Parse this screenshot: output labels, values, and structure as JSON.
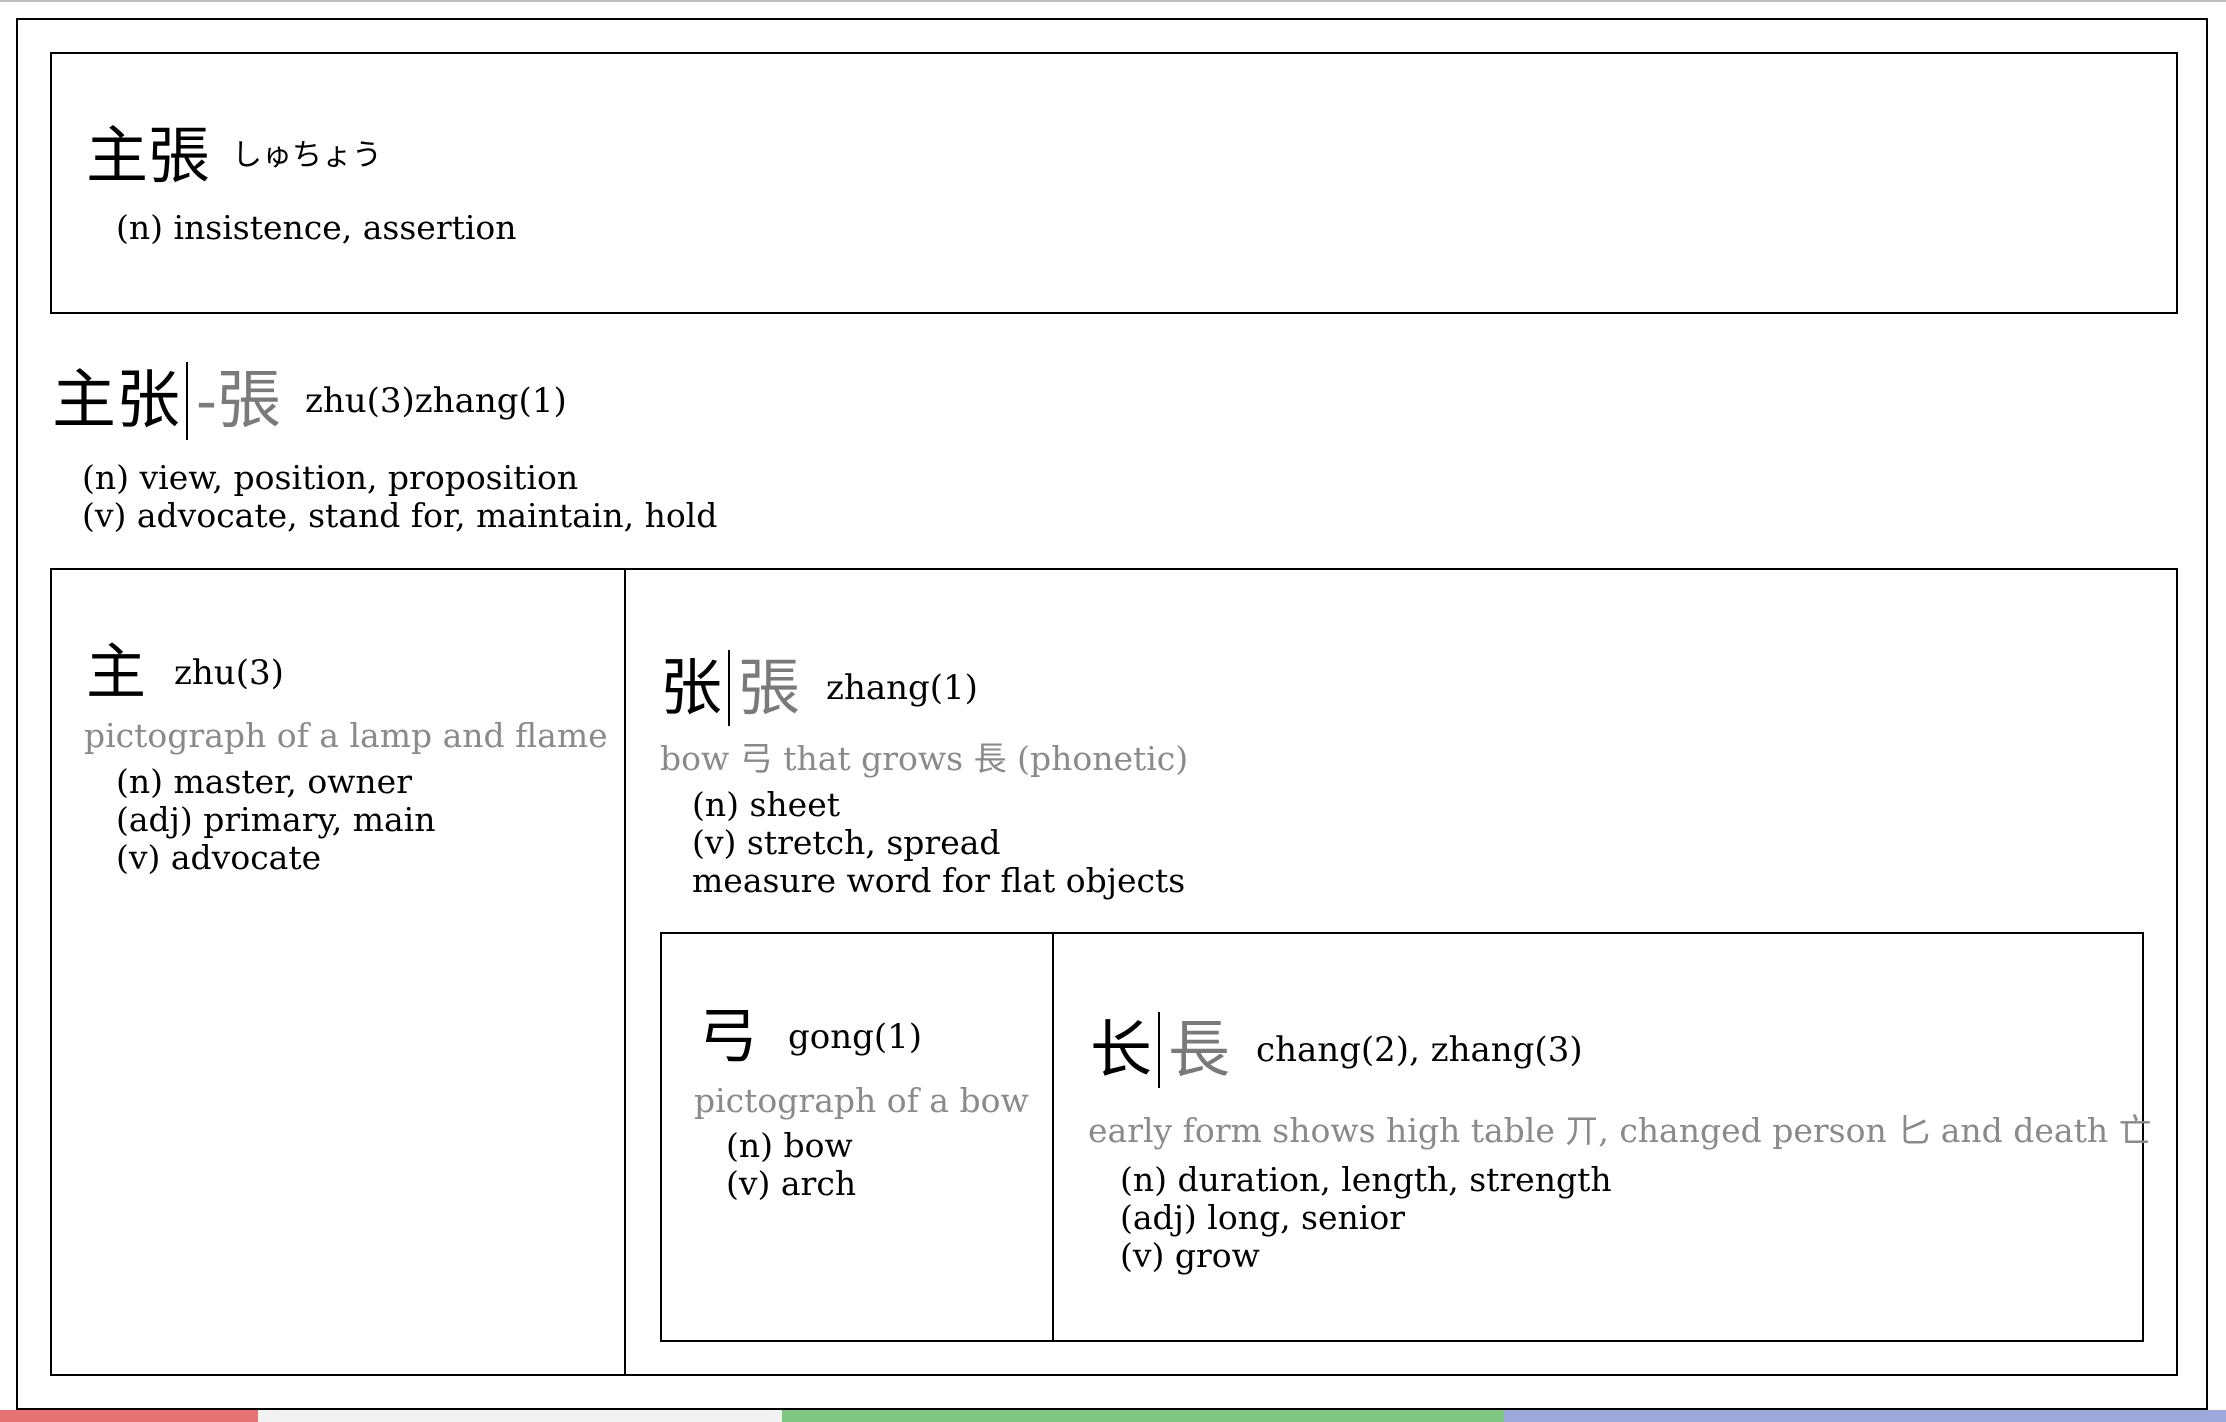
{
  "japanese_entry": {
    "word": "主張",
    "kana": "しゅちょう",
    "definitions": [
      "(n) insistence, assertion"
    ]
  },
  "compound_entry": {
    "simplified": "主张",
    "separator": "-",
    "traditional": "張",
    "pinyin": "zhu(3)zhang(1)",
    "definitions": [
      "(n) view, position, proposition",
      "(v) advocate, stand for, maintain, hold"
    ]
  },
  "char_zhu": {
    "char": "主",
    "pinyin": "zhu(3)",
    "etymology": "pictograph of a lamp and flame",
    "definitions": [
      "(n) master, owner",
      "(adj) primary, main",
      "(v) advocate"
    ]
  },
  "char_zhang": {
    "simplified": "张",
    "traditional": "張",
    "pinyin": "zhang(1)",
    "etymology": "bow 弓 that grows 長 (phonetic)",
    "definitions": [
      "(n) sheet",
      "(v) stretch, spread",
      "measure word for flat objects"
    ]
  },
  "char_gong": {
    "char": "弓",
    "pinyin": "gong(1)",
    "etymology": "pictograph of a bow",
    "definitions": [
      "(n) bow",
      "(v) arch"
    ]
  },
  "char_chang": {
    "simplified": "长",
    "traditional": "長",
    "pinyin": "chang(2), zhang(3)",
    "etymology": "early form shows high table 丌, changed person 匕 and death 亡",
    "definitions": [
      "(n) duration, length, strength",
      "(adj) long, senior",
      "(v) grow"
    ]
  },
  "colors": {
    "border": "#000000",
    "traditional_char": "#7a7a7a",
    "etymology_text": "#8a8a8a",
    "strip": [
      "#e57373",
      "#f2f2f2",
      "#81c784",
      "#9fa8da"
    ]
  }
}
